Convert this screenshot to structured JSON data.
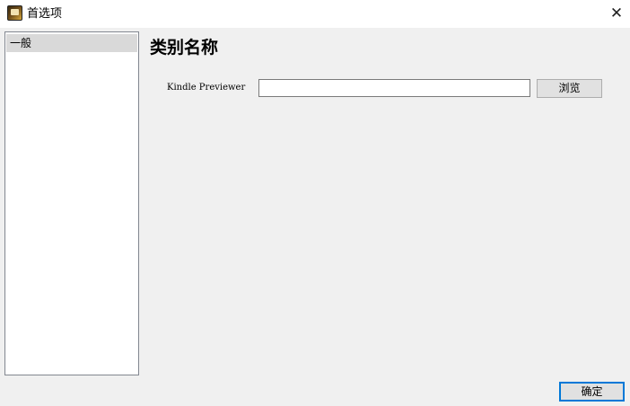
{
  "window": {
    "title": "首选项",
    "close_glyph": "✕",
    "icon": "kindle-app-icon"
  },
  "sidebar": {
    "items": [
      {
        "label": "一般",
        "selected": true
      }
    ]
  },
  "main": {
    "section_title": "类别名称",
    "kindle_previewer": {
      "label": "Kindle Previewer",
      "value": "",
      "placeholder": ""
    },
    "browse_label": "浏览"
  },
  "footer": {
    "ok_label": "确定"
  },
  "colors": {
    "titlebar": "#ffffff",
    "background": "#f0f0f0",
    "selected_item": "#d9d9d9",
    "focus_border": "#0078d7"
  }
}
